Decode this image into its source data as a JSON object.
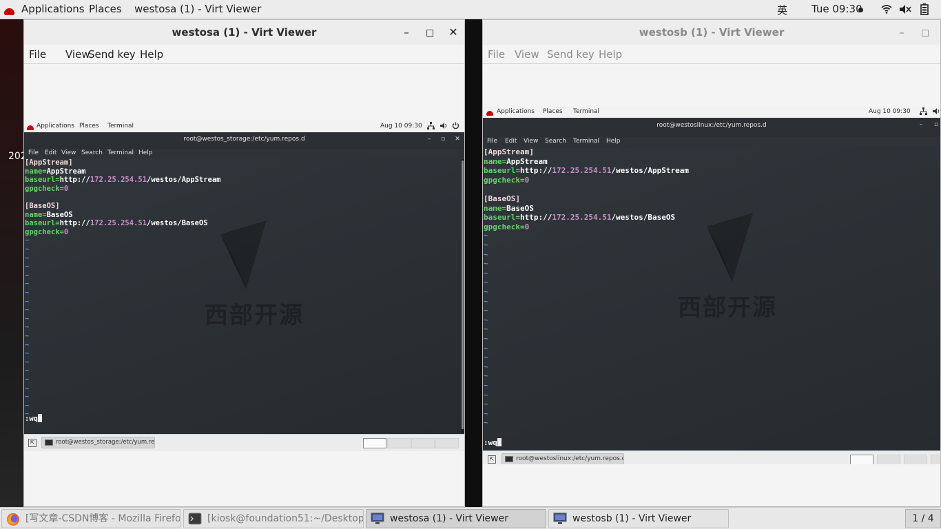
{
  "topbar": {
    "applications": "Applications",
    "places": "Places",
    "window_title": "westosa (1) - Virt Viewer",
    "input_method": "英",
    "clock": "Tue 09:30"
  },
  "desktop": {
    "peek_text": "202"
  },
  "vv_a": {
    "title": "westosa (1) - Virt Viewer",
    "menu": [
      "File",
      "View",
      "Send key",
      "Help"
    ],
    "guest": {
      "top": {
        "applications": "Applications",
        "places": "Places",
        "terminal": "Terminal",
        "clock": "Aug 10  09:30"
      },
      "term_title": "root@westos_storage:/etc/yum.repos.d",
      "term_menu": [
        "File",
        "Edit",
        "View",
        "Search",
        "Terminal",
        "Help"
      ],
      "command": ":wq",
      "task_label": "root@westos_storage:/etc/yum.rep..."
    }
  },
  "vv_b": {
    "title": "westosb (1) - Virt Viewer",
    "menu": [
      "File",
      "View",
      "Send key",
      "Help"
    ],
    "guest": {
      "top": {
        "applications": "Applications",
        "places": "Places",
        "terminal": "Terminal",
        "clock": "Aug 10  09:30"
      },
      "term_title": "root@westoslinux:/etc/yum.repos.d",
      "term_menu": [
        "File",
        "Edit",
        "View",
        "Search",
        "Terminal",
        "Help"
      ],
      "command": ":wq",
      "task_label": "root@westoslinux:/etc/yum.repos.d"
    }
  },
  "repo": {
    "s1": "[AppStream]",
    "n1k": "name=",
    "n1v": "AppStream",
    "b1k": "baseurl=",
    "b1a": "http://",
    "b1ip": "172.25.254.51",
    "b1p": "/westos/AppStream",
    "g1k": "gpgcheck=",
    "g1v": "0",
    "s2": "[BaseOS]",
    "n2k": "name=",
    "n2v": "BaseOS",
    "b2k": "baseurl=",
    "b2a": "http://",
    "b2ip": "172.25.254.51",
    "b2p": "/westos/BaseOS",
    "g2k": "gpgcheck=",
    "g2v": "0"
  },
  "watermark": "西部开源",
  "hostbar": {
    "tasks": [
      "[写文章-CSDN博客 - Mozilla Firefox]",
      "[kiosk@foundation51:~/Desktop]",
      "westosa (1) - Virt Viewer",
      "westosb (1) - Virt Viewer"
    ],
    "pager": "1 / 4"
  },
  "colors": {
    "terminal_bg": "#2b3035",
    "key_green": "#64d46b",
    "ip_magenta": "#c98fc9",
    "tilde_blue": "#5a8fd6"
  }
}
